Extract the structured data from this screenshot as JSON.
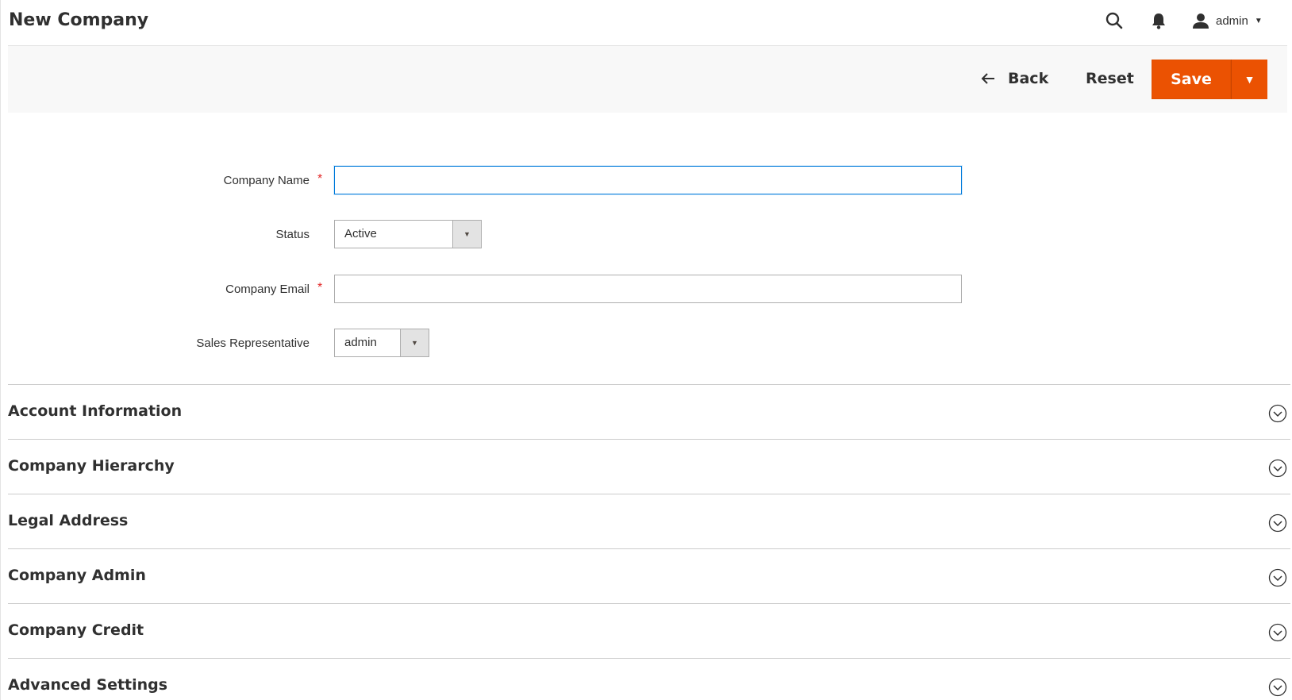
{
  "header": {
    "title": "New Company",
    "user_name": "admin",
    "icons": [
      "search-icon",
      "bell-icon",
      "user-icon",
      "caret-down-icon"
    ]
  },
  "actions": {
    "back_label": "Back",
    "reset_label": "Reset",
    "save_label": "Save"
  },
  "form": {
    "company_name": {
      "label": "Company Name",
      "required_mark": "*",
      "value": ""
    },
    "status": {
      "label": "Status",
      "value": "Active"
    },
    "company_email": {
      "label": "Company Email",
      "required_mark": "*",
      "value": ""
    },
    "sales_rep": {
      "label": "Sales Representative",
      "value": "admin"
    }
  },
  "sections": [
    {
      "title": "Account Information"
    },
    {
      "title": "Company Hierarchy"
    },
    {
      "title": "Legal Address"
    },
    {
      "title": "Company Admin"
    },
    {
      "title": "Company Credit"
    },
    {
      "title": "Advanced Settings"
    }
  ],
  "colors": {
    "accent": "#eb5202",
    "focus": "#007bdb",
    "required": "#e22626"
  }
}
